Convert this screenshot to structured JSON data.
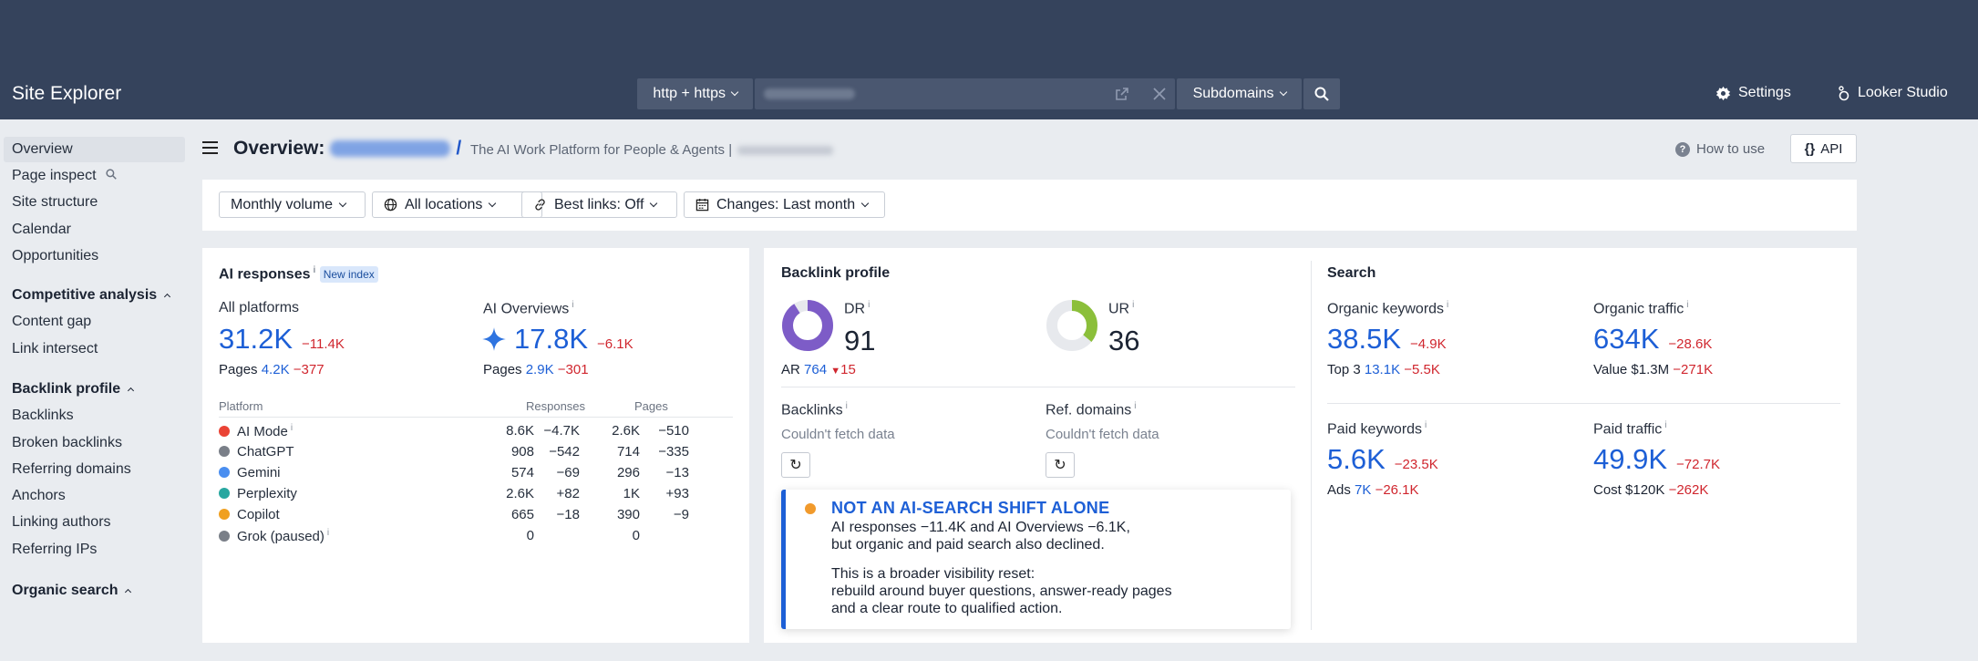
{
  "app": {
    "title": "Site Explorer"
  },
  "topbar": {
    "protocol": "http + https",
    "subdomains": "Subdomains",
    "settings": "Settings",
    "looker": "Looker Studio"
  },
  "sidebar": {
    "items": [
      {
        "label": "Overview"
      },
      {
        "label": "Page inspect"
      },
      {
        "label": "Site structure"
      },
      {
        "label": "Calendar"
      },
      {
        "label": "Opportunities"
      },
      {
        "label": "Competitive analysis"
      },
      {
        "label": "Content gap"
      },
      {
        "label": "Link intersect"
      },
      {
        "label": "Backlink profile"
      },
      {
        "label": "Backlinks"
      },
      {
        "label": "Broken backlinks"
      },
      {
        "label": "Referring domains"
      },
      {
        "label": "Anchors"
      },
      {
        "label": "Linking authors"
      },
      {
        "label": "Referring IPs"
      },
      {
        "label": "Organic search"
      }
    ]
  },
  "header": {
    "title": "Overview:",
    "slash": "/",
    "tagline": "The AI Work Platform for People & Agents |",
    "how_to_use": "How to use",
    "api": "API"
  },
  "filters": {
    "volume": "Monthly volume",
    "locations": "All locations",
    "best_links": "Best links: Off",
    "changes": "Changes: Last month"
  },
  "ai_responses": {
    "title": "AI responses",
    "badge": "New index",
    "all_platforms": {
      "label": "All platforms",
      "value": "31.2K",
      "delta": "−11.4K",
      "pages_label": "Pages",
      "pages": "4.2K",
      "pages_delta": "−377"
    },
    "ai_overviews": {
      "label": "AI Overviews",
      "value": "17.8K",
      "delta": "−6.1K",
      "pages_label": "Pages",
      "pages": "2.9K",
      "pages_delta": "−301"
    },
    "table": {
      "headers": [
        "Platform",
        "Responses",
        "Pages"
      ],
      "rows": [
        {
          "platform": "AI Mode",
          "responses": "8.6K",
          "responses_delta": "−4.7K",
          "pages": "2.6K",
          "pages_delta": "−510"
        },
        {
          "platform": "ChatGPT",
          "responses": "908",
          "responses_delta": "−542",
          "pages": "714",
          "pages_delta": "−335"
        },
        {
          "platform": "Gemini",
          "responses": "574",
          "responses_delta": "−69",
          "pages": "296",
          "pages_delta": "−13"
        },
        {
          "platform": "Perplexity",
          "responses": "2.6K",
          "responses_delta": "+82",
          "pages": "1K",
          "pages_delta": "+93"
        },
        {
          "platform": "Copilot",
          "responses": "665",
          "responses_delta": "−18",
          "pages": "390",
          "pages_delta": "−9"
        },
        {
          "platform": "Grok (paused)",
          "responses": "0",
          "responses_delta": "",
          "pages": "0",
          "pages_delta": ""
        }
      ]
    }
  },
  "backlink_profile": {
    "title": "Backlink profile",
    "dr": {
      "label": "DR",
      "value": "91"
    },
    "ur": {
      "label": "UR",
      "value": "36"
    },
    "ar": {
      "label": "AR",
      "value": "764",
      "delta": "15"
    },
    "backlinks": {
      "label": "Backlinks",
      "status": "Couldn't fetch data"
    },
    "ref_domains": {
      "label": "Ref. domains",
      "status": "Couldn't fetch data"
    }
  },
  "search": {
    "title": "Search",
    "organic_keywords": {
      "label": "Organic keywords",
      "value": "38.5K",
      "delta": "−4.9K",
      "sub_label": "Top 3",
      "sub_value": "13.1K",
      "sub_delta": "−5.5K"
    },
    "organic_traffic": {
      "label": "Organic traffic",
      "value": "634K",
      "delta": "−28.6K",
      "sub_label": "Value $1.3M",
      "sub_delta": "−271K"
    },
    "paid_keywords": {
      "label": "Paid keywords",
      "value": "5.6K",
      "delta": "−23.5K",
      "sub_label": "Ads",
      "sub_value": "7K",
      "sub_delta": "−26.1K"
    },
    "paid_traffic": {
      "label": "Paid traffic",
      "value": "49.9K",
      "delta": "−72.7K",
      "sub_label": "Cost $120K",
      "sub_delta": "−262K"
    }
  },
  "callout": {
    "title": "NOT AN AI-SEARCH SHIFT ALONE",
    "line1": "AI responses −11.4K and AI Overviews −6.1K,",
    "line2": "but organic and paid search also declined.",
    "line3": "This is a broader visibility reset:",
    "line4": "rebuild around buyer questions, answer-ready pages",
    "line5": "and a clear route to qualified action."
  },
  "colors": {
    "accent": "#1d5fd6",
    "negative": "#d0262e",
    "positive": "#1f9a4a",
    "topbar": "#35435c",
    "dr_ring": "#7d5cc7",
    "ur_ring": "#8bbf3a"
  },
  "gauges": {
    "dr_level": 0.91,
    "ur_level": 0.36
  }
}
